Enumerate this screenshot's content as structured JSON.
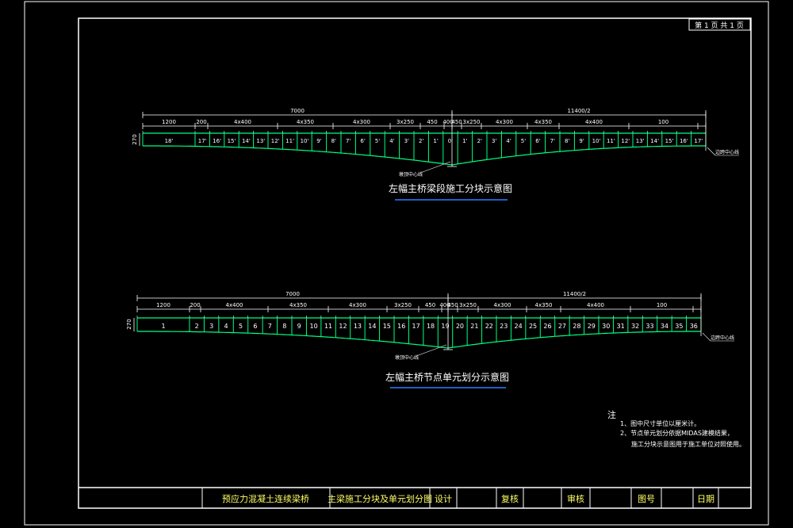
{
  "sheet": {
    "page_label": "第 1 页 共 1 页"
  },
  "diagram1": {
    "title": "左幅主桥梁段施工分块示意图",
    "span_left": "7000",
    "span_right": "11400/2",
    "dims_left": [
      "1200",
      "200",
      "4x400",
      "4x350",
      "4x300",
      "3x250",
      "450",
      "400"
    ],
    "dims_right": [
      "450",
      "3x250",
      "4x300",
      "4x350",
      "4x400",
      "100"
    ],
    "height_label": "270",
    "segments": [
      "18'",
      "17'",
      "16'",
      "15'",
      "14'",
      "13'",
      "12'",
      "11'",
      "10'",
      "9'",
      "8'",
      "7'",
      "6'",
      "5'",
      "4'",
      "3'",
      "2'",
      "1'",
      "0'",
      "1'",
      "2'",
      "3'",
      "4'",
      "5'",
      "6'",
      "7'",
      "8'",
      "9'",
      "10'",
      "11'",
      "12'",
      "13'",
      "14'",
      "15'",
      "16'",
      "17'"
    ],
    "callout_pier": "墩顶中心线",
    "callout_end": "边跨中心线"
  },
  "diagram2": {
    "title": "左幅主桥节点单元划分示意图",
    "span_left": "7000",
    "span_right": "11400/2",
    "dims_left": [
      "1200",
      "200",
      "4x400",
      "4x350",
      "4x300",
      "3x250",
      "450",
      "400"
    ],
    "dims_right": [
      "450",
      "3x250",
      "4x300",
      "4x350",
      "4x400",
      "100"
    ],
    "height_label": "270",
    "elements": [
      "1",
      "2",
      "3",
      "4",
      "5",
      "6",
      "7",
      "8",
      "9",
      "10",
      "11",
      "12",
      "13",
      "14",
      "15",
      "16",
      "17",
      "18",
      "19",
      "20",
      "21",
      "22",
      "23",
      "24",
      "25",
      "26",
      "27",
      "28",
      "29",
      "30",
      "31",
      "32",
      "33",
      "34",
      "35",
      "36"
    ],
    "callout_pier": "墩顶中心线",
    "callout_end": "边跨中心线"
  },
  "notes": {
    "heading": "注",
    "items": [
      "1、图中尺寸单位以厘米计。",
      "2、节点单元划分依据MIDAS建模结果，",
      "施工分块示意图用于施工单位对照使用。"
    ]
  },
  "title_block": {
    "project": "预应力混凝土连续梁桥",
    "drawing": "主梁施工分块及单元划分图",
    "design": "设计",
    "check": "复核",
    "review": "审核",
    "number": "图号",
    "date": "日期"
  },
  "colors": {
    "beam": "#00ff7f",
    "dim": "#ffffff",
    "line": "#00ffff",
    "underline": "#2a7fff"
  }
}
